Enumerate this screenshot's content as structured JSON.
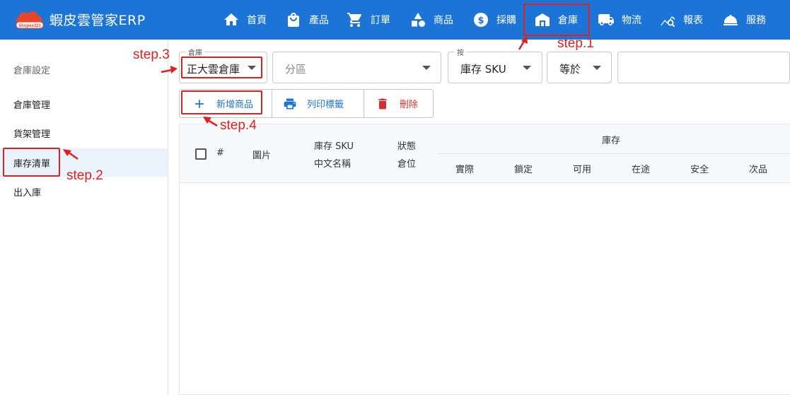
{
  "brand": {
    "title": "蝦皮雲管家ERP",
    "logo_text": "Shopee321",
    "logo_color": "#e8452c"
  },
  "nav": {
    "items": [
      {
        "label": "首頁",
        "icon": "home-icon"
      },
      {
        "label": "產品",
        "icon": "bag-icon"
      },
      {
        "label": "訂單",
        "icon": "cart-icon"
      },
      {
        "label": "商品",
        "icon": "shapes-icon"
      },
      {
        "label": "採購",
        "icon": "dollar-icon"
      },
      {
        "label": "倉庫",
        "icon": "warehouse-icon"
      },
      {
        "label": "物流",
        "icon": "truck-icon"
      },
      {
        "label": "報表",
        "icon": "chart-icon"
      },
      {
        "label": "服務",
        "icon": "service-bell-icon"
      }
    ],
    "active": "倉庫",
    "bg_color": "#1b74d6"
  },
  "sidebar": {
    "header": "倉庫設定",
    "items": [
      {
        "label": "倉庫管理"
      },
      {
        "label": "貨架管理"
      },
      {
        "label": "庫存清單"
      },
      {
        "label": "出入庫"
      }
    ],
    "active": "庫存清單"
  },
  "filters": {
    "warehouse": {
      "legend": "倉庫",
      "value": "正大雲倉庫"
    },
    "zone": {
      "placeholder": "分區"
    },
    "by": {
      "legend": "按",
      "value": "庫存 SKU"
    },
    "op": {
      "value": "等於"
    },
    "search": {
      "value": ""
    }
  },
  "actions": {
    "add": "新增商品",
    "print": "列印標籤",
    "delete": "刪除",
    "colors": {
      "add": "#1b74d6",
      "print": "#1b74d6",
      "delete": "#d32f2f"
    }
  },
  "table": {
    "headers": {
      "index": "#",
      "image": "圖片",
      "sku": "庫存 SKU",
      "name": "中文名稱",
      "status": "狀態",
      "location": "倉位",
      "stock": "庫存",
      "stock_columns": [
        "實際",
        "鎖定",
        "可用",
        "在途",
        "安全",
        "次品"
      ]
    },
    "rows": []
  },
  "annotations": {
    "step1": "step.1",
    "step2": "step.2",
    "step3": "step.3",
    "step4": "step.4",
    "color": "#e02020"
  }
}
